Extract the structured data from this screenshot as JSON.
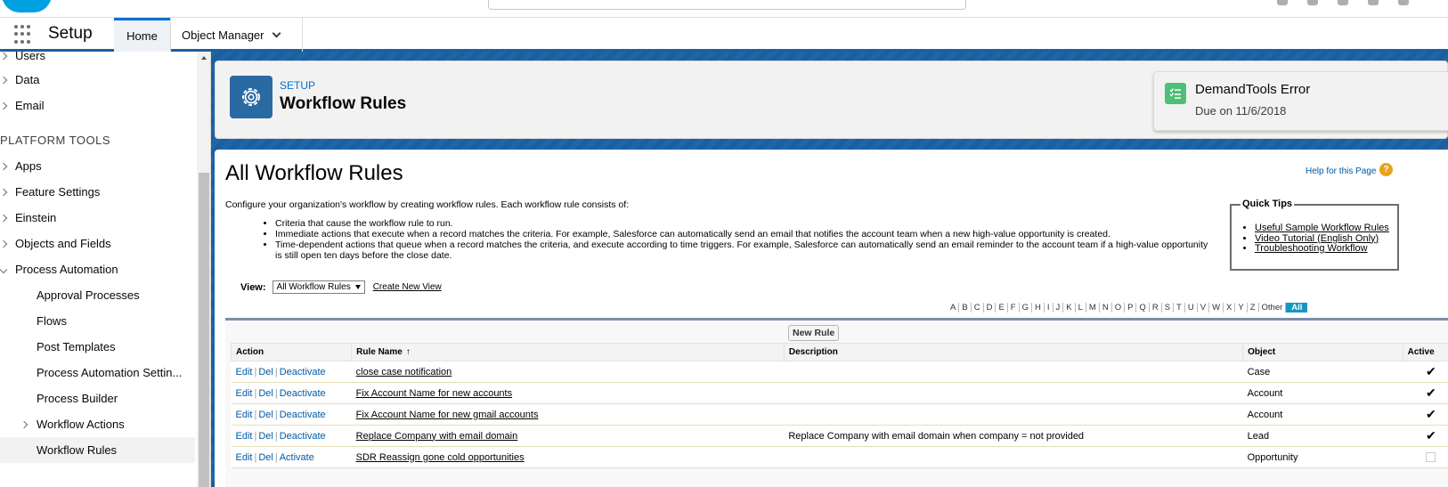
{
  "header": {
    "app_name": "Setup",
    "tabs": [
      {
        "label": "Home"
      },
      {
        "label": "Object Manager"
      }
    ]
  },
  "sidebar": {
    "top_items": [
      {
        "label": "Users"
      },
      {
        "label": "Data"
      },
      {
        "label": "Email"
      }
    ],
    "section_title": "PLATFORM TOOLS",
    "items": [
      {
        "label": "Apps"
      },
      {
        "label": "Feature Settings"
      },
      {
        "label": "Einstein"
      },
      {
        "label": "Objects and Fields"
      },
      {
        "label": "Process Automation"
      }
    ],
    "children": [
      {
        "label": "Approval Processes"
      },
      {
        "label": "Flows"
      },
      {
        "label": "Post Templates"
      },
      {
        "label": "Process Automation Settin..."
      },
      {
        "label": "Process Builder"
      },
      {
        "label": "Workflow Actions"
      },
      {
        "label": "Workflow Rules"
      }
    ]
  },
  "page_header": {
    "eyebrow": "SETUP",
    "title": "Workflow Rules"
  },
  "toast": {
    "title": "DemandTools Error",
    "subtitle": "Due on 11/6/2018"
  },
  "content": {
    "heading": "All Workflow Rules",
    "help_link": "Help for this Page",
    "help_icon": "?",
    "intro": "Configure your organization's workflow by creating workflow rules. Each workflow rule consists of:",
    "bullets": [
      "Criteria that cause the workflow rule to run.",
      "Immediate actions that execute when a record matches the criteria. For example, Salesforce can automatically send an email that notifies the account team when a new high-value opportunity is created.",
      "Time-dependent actions that queue when a record matches the criteria, and execute according to time triggers. For example, Salesforce can automatically send an email reminder to the account team if a high-value opportunity is still open ten days before the close date."
    ],
    "quick_tips": {
      "title": "Quick Tips",
      "links": [
        "Useful Sample Workflow Rules",
        "Video Tutorial (English Only)",
        "Troubleshooting Workflow"
      ]
    },
    "view_label": "View:",
    "view_selected": "All Workflow Rules",
    "create_view": "Create New View",
    "alphabet": [
      "A",
      "B",
      "C",
      "D",
      "E",
      "F",
      "G",
      "H",
      "I",
      "J",
      "K",
      "L",
      "M",
      "N",
      "O",
      "P",
      "Q",
      "R",
      "S",
      "T",
      "U",
      "V",
      "W",
      "X",
      "Y",
      "Z",
      "Other",
      "All"
    ],
    "new_rule_button": "New Rule",
    "columns": {
      "action": "Action",
      "rule_name": "Rule Name",
      "sort_icon": "↑",
      "description": "Description",
      "object": "Object",
      "active": "Active"
    },
    "action_labels": {
      "edit": "Edit",
      "del": "Del",
      "sep": "|"
    },
    "rows": [
      {
        "toggle": "Deactivate",
        "name": "close case notification",
        "description": "",
        "object": "Case",
        "active": true
      },
      {
        "toggle": "Deactivate",
        "name": "Fix Account Name for new accounts",
        "description": "",
        "object": "Account",
        "active": true
      },
      {
        "toggle": "Deactivate",
        "name": "Fix Account Name for new gmail accounts",
        "description": "",
        "object": "Account",
        "active": true
      },
      {
        "toggle": "Deactivate",
        "name": "Replace Company with email domain",
        "description": "Replace Company with email domain when company = not provided",
        "object": "Lead",
        "active": true
      },
      {
        "toggle": "Activate",
        "name": "SDR Reassign gone cold opportunities",
        "description": "",
        "object": "Opportunity",
        "active": false
      }
    ],
    "checkmark": "✔"
  },
  "colors": {
    "brand_blue": "#1b5f9e",
    "link_blue": "#015ba7",
    "toast_green": "#4bc076",
    "setup_icon": "#2a6aa3"
  }
}
